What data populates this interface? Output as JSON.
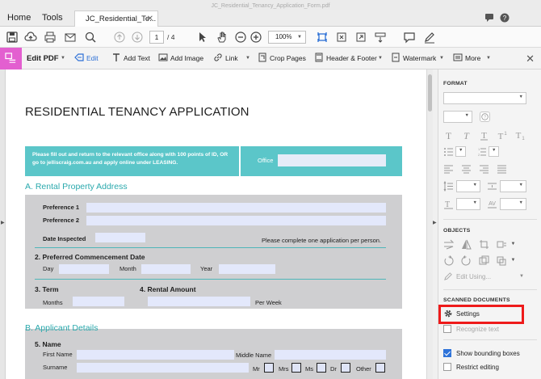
{
  "window": {
    "title": "JC_Residential_Tenancy_Application_Form.pdf"
  },
  "tabs": {
    "home": "Home",
    "tools": "Tools",
    "document": "JC_Residential_Te..."
  },
  "toolbar": {
    "page_current": "1",
    "page_total": "/ 4",
    "zoom": "100%"
  },
  "edit_toolbar": {
    "title": "Edit PDF",
    "items": [
      "Edit",
      "Add Text",
      "Add Image",
      "Link",
      "Crop Pages",
      "Header & Footer",
      "Watermark",
      "More"
    ]
  },
  "document": {
    "title": "RESIDENTIAL TENANCY APPLICATION",
    "intro": "Please fill out and return to the relevant office along with 100 points of ID, OR go to jelliscraig.com.au and apply online under LEASING.",
    "office_label": "Office",
    "section_a": "A. Rental Property Address",
    "preference_1": "Preference 1",
    "preference_2": "Preference 2",
    "date_inspected": "Date Inspected",
    "one_application": "Please complete one application per person.",
    "preferred_commencement": "2. Preferred Commencement Date",
    "day": "Day",
    "month": "Month",
    "year": "Year",
    "term": "3. Term",
    "rental_amount": "4. Rental Amount",
    "months": "Months",
    "per_week": "Per Week",
    "section_b": "B. Applicant Details",
    "name": "5. Name",
    "first_name": "First Name",
    "middle_name": "Middle Name",
    "surname": "Surname",
    "titles": [
      "Mr",
      "Mrs",
      "Ms",
      "Dr",
      "Other"
    ]
  },
  "right_panel": {
    "format": "FORMAT",
    "objects": "OBJECTS",
    "edit_using": "Edit Using...",
    "scanned_documents": "SCANNED DOCUMENTS",
    "settings": "Settings",
    "recognize_text": "Recognize text",
    "show_bounding_boxes": "Show bounding boxes",
    "restrict_editing": "Restrict editing"
  },
  "accent_colors": {
    "teal": "#5bc6c9",
    "edit_badge": "#e35fd0",
    "highlight": "#ee1b1b",
    "active_blue": "#2b6fd6"
  }
}
